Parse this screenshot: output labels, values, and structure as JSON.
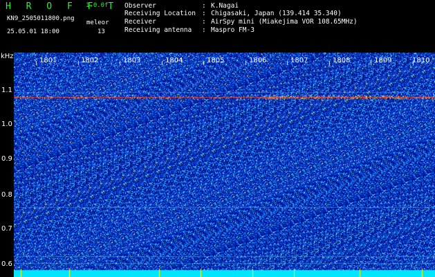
{
  "header": {
    "title": "H R O F F T",
    "version": "1.0.0f",
    "filename": "KN9_2505011800.png",
    "method": "meleor",
    "timestamp": "25.05.01 18:00",
    "count": "13"
  },
  "info": [
    {
      "key": "Observer",
      "value": "K.Nagai"
    },
    {
      "key": "Receiving Location",
      "value": "Chigasaki, Japan (139.414 35.340)"
    },
    {
      "key": "Receiver",
      "value": "AirSpy mini (Miakejima VOR 108.65MHz)"
    },
    {
      "key": "Receiving antenna",
      "value": "Maspro FM-3"
    }
  ],
  "separator": ":",
  "axis": {
    "y_unit": "kHz",
    "y_ticks": [
      "1.1",
      "1.0",
      "0.9",
      "0.8",
      "0.7",
      "0.6"
    ],
    "x_ticks": [
      "1801",
      "1802",
      "1803",
      "1804",
      "1805",
      "1806",
      "1807",
      "1808",
      "1809",
      "1810"
    ]
  },
  "colors": {
    "background": "#000000",
    "spectrogram_base": "#001a8c",
    "carrier_line": "#ff3020",
    "bottom_band": "#00e6ff",
    "marker": "#ffff00"
  }
}
